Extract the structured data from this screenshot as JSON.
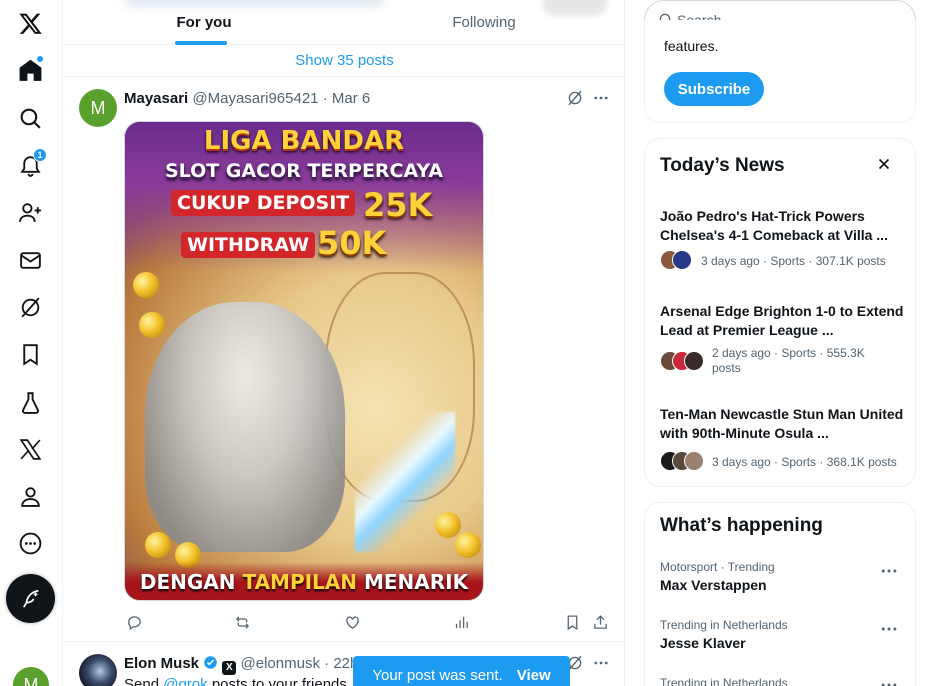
{
  "nav": {
    "notifications_badge": "1"
  },
  "tabs": [
    {
      "label": "For you",
      "active": true
    },
    {
      "label": "Following",
      "active": false
    }
  ],
  "show_posts": "Show 35 posts",
  "post1": {
    "avatar_letter": "M",
    "name": "Mayasari",
    "handle": "@Mayasari965421",
    "date": "Mar 6",
    "media_text": {
      "line1": "LIGA BANDAR",
      "line2": "SLOT GACOR TERPERCAYA",
      "line3": "CUKUP DEPOSIT",
      "line4": "25K",
      "line5": "WITHDRAW",
      "line6": "50K",
      "line7a": "DENGAN",
      "line7b": "TAMPILAN",
      "line7c": "MENARIK"
    }
  },
  "post2": {
    "name": "Elon Musk",
    "handle": "@elonmusk",
    "date": "22h",
    "text_prefix": "Send",
    "text_link": "@grok",
    "text_suffix": "posts to your friends"
  },
  "toast": {
    "message": "Your post was sent.",
    "action": "View"
  },
  "search": {
    "placeholder": "Search"
  },
  "premium": {
    "text": "features.",
    "button": "Subscribe"
  },
  "news": {
    "title": "Today’s News",
    "items": [
      {
        "headline": "João Pedro's Hat-Trick Powers Chelsea's 4-1 Comeback at Villa ...",
        "meta": "3 days ago · Sports · 307.1K posts"
      },
      {
        "headline": "Arsenal Edge Brighton 1-0 to Extend Lead at Premier League ...",
        "meta_line1": "2 days ago · Sports · 555.3K",
        "meta_line2": "posts"
      },
      {
        "headline": "Ten-Man Newcastle Stun Man United with 90th-Minute Osula ...",
        "meta": "3 days ago · Sports · 368.1K posts"
      }
    ]
  },
  "happening": {
    "title": "What’s happening",
    "items": [
      {
        "context": "Motorsport · Trending",
        "name": "Max Verstappen"
      },
      {
        "context": "Trending in Netherlands",
        "name": "Jesse Klaver"
      },
      {
        "context": "Trending in Netherlands",
        "name": ""
      }
    ]
  },
  "colors": {
    "accent": "#1d9bf0",
    "text": "#0f1419",
    "secondary": "#536471",
    "border": "#eff3f4"
  }
}
